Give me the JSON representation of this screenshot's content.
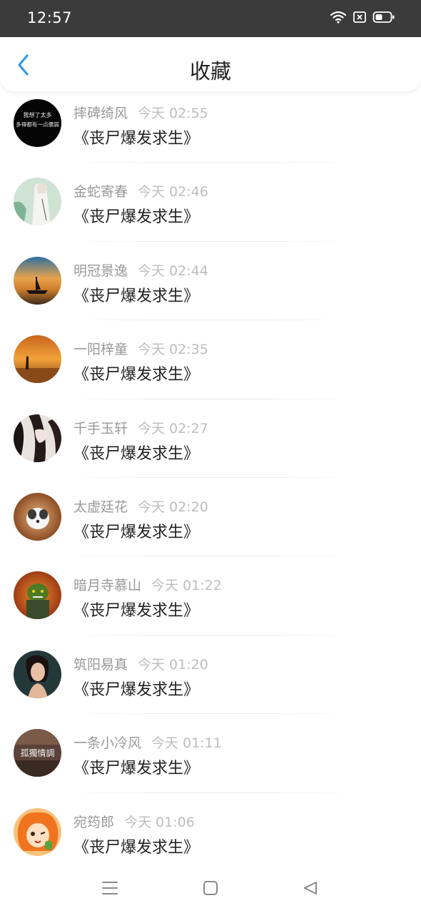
{
  "status_bar": {
    "time": "12:57",
    "icons": [
      "wifi-icon",
      "sim-card-icon",
      "battery-icon"
    ]
  },
  "header": {
    "title": "收藏",
    "back_icon": "back-chevron-icon",
    "accent_color": "#2f9be8"
  },
  "items": [
    {
      "name": "摔碑绮风",
      "time": "今天 02:55",
      "book": "《丧尸爆发求生》",
      "avatar_text": [
        "我想了太多",
        "多得都有一点儒弱"
      ]
    },
    {
      "name": "金蛇寄春",
      "time": "今天 02:46",
      "book": "《丧尸爆发求生》"
    },
    {
      "name": "明冠景逸",
      "time": "今天 02:44",
      "book": "《丧尸爆发求生》"
    },
    {
      "name": "一阳梓童",
      "time": "今天 02:35",
      "book": "《丧尸爆发求生》"
    },
    {
      "name": "千手玉轩",
      "time": "今天 02:27",
      "book": "《丧尸爆发求生》"
    },
    {
      "name": "太虚廷花",
      "time": "今天 02:20",
      "book": "《丧尸爆发求生》"
    },
    {
      "name": "暗月寺慕山",
      "time": "今天 01:22",
      "book": "《丧尸爆发求生》"
    },
    {
      "name": "筑阳易真",
      "time": "今天 01:20",
      "book": "《丧尸爆发求生》"
    },
    {
      "name": "一条小冷风",
      "time": "今天 01:11",
      "book": "《丧尸爆发求生》",
      "avatar_text": [
        "孤獨情調"
      ]
    },
    {
      "name": "宛筠郎",
      "time": "今天 01:06",
      "book": "《丧尸爆发求生》"
    }
  ],
  "nav_bar": {
    "icons": [
      "menu-icon",
      "home-square-icon",
      "back-triangle-icon"
    ]
  }
}
